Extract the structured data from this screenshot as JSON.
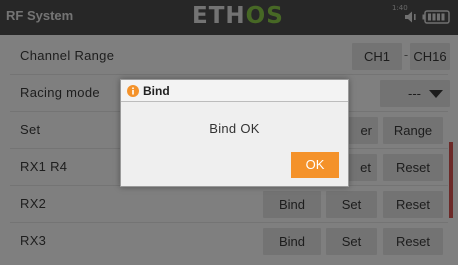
{
  "header": {
    "title": "RF System",
    "logo_part1": "ETH",
    "logo_part2": "OS",
    "status_text": "1:40",
    "speaker_icon": "speaker-icon",
    "battery_icon": "battery-icon"
  },
  "rows": [
    {
      "label": "Channel Range",
      "range_start": "CH1",
      "range_sep": "-",
      "range_end": "CH16"
    },
    {
      "label": "Racing mode",
      "select_value": "---"
    },
    {
      "label": "Set",
      "button_partial": "er",
      "button_range": "Range"
    },
    {
      "label": "RX1  R4",
      "button_set_partial": "et",
      "button_reset": "Reset"
    },
    {
      "label": "RX2",
      "button_bind": "Bind",
      "button_set": "Set",
      "button_reset": "Reset"
    },
    {
      "label": "RX3",
      "button_bind": "Bind",
      "button_set": "Set",
      "button_reset": "Reset"
    }
  ],
  "dialog": {
    "title": "Bind",
    "message": "Bind OK",
    "ok_label": "OK",
    "icon": "info-icon"
  },
  "colors": {
    "accent": "#f4922a",
    "title_bar": "#4f4f4f",
    "logo_green": "#8fd14b",
    "scrollbar": "#d9534f"
  }
}
